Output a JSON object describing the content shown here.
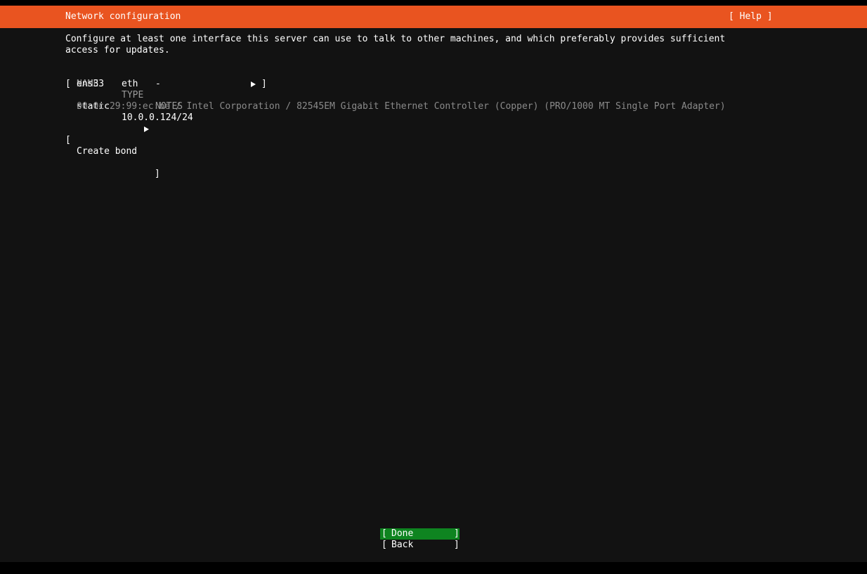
{
  "header": {
    "title": "Network configuration",
    "help_label": "[ Help ]"
  },
  "description": "Configure at least one interface this server can use to talk to other machines, and which preferably provides sufficient access for updates.",
  "table": {
    "columns": [
      "NAME",
      "TYPE",
      "NOTES"
    ],
    "interfaces": [
      {
        "name": "ens33",
        "type": "eth",
        "notes": "-",
        "address_mode": "static",
        "address": "10.0.0.124/24",
        "hardware": "00:0c:29:99:ec:be / Intel Corporation / 82545EM Gigabit Ethernet Controller (Copper) (PRO/1000 MT Single Port Adapter)"
      }
    ]
  },
  "create_bond_label": "Create bond",
  "buttons": {
    "done": "Done",
    "back": "Back"
  },
  "colors": {
    "header": "#e95420",
    "done_button": "#0e8420",
    "background": "#121212"
  }
}
